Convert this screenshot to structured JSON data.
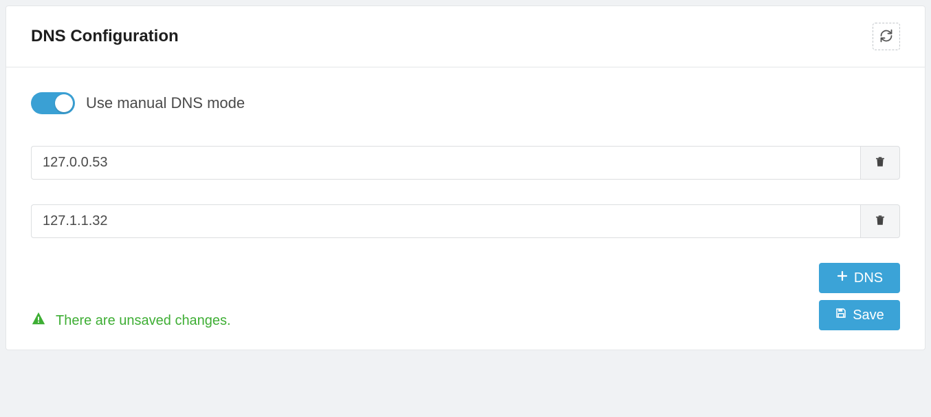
{
  "panel": {
    "title": "DNS Configuration"
  },
  "toggle": {
    "label": "Use manual DNS mode",
    "on": true
  },
  "dns_entries": [
    {
      "value": "127.0.0.53"
    },
    {
      "value": "127.1.1.32"
    }
  ],
  "status": {
    "message": "There are unsaved changes."
  },
  "buttons": {
    "add_dns_label": "DNS",
    "save_label": "Save"
  },
  "colors": {
    "accent": "#3ba3d7",
    "success": "#3eae34"
  }
}
